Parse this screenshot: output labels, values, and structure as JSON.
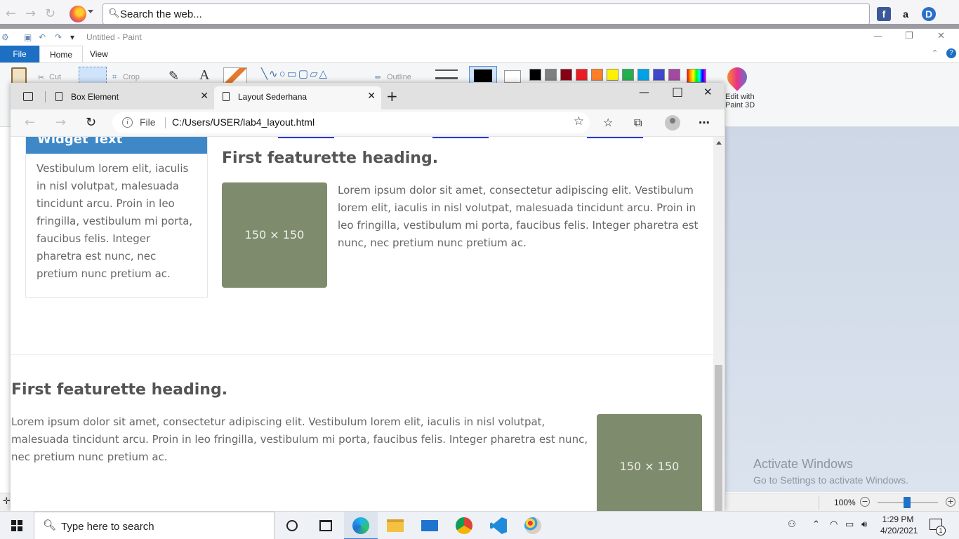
{
  "firefox": {
    "search_placeholder": "Search the web..."
  },
  "paint": {
    "title": "Untitled - Paint",
    "tabs": {
      "file": "File",
      "home": "Home",
      "view": "View"
    },
    "ribbon": {
      "cut": "Cut",
      "crop": "Crop",
      "outline": "Outline",
      "edit_with": "Edit with",
      "paint_3d": "Paint 3D",
      "colors": [
        "#000000",
        "#7f7f7f",
        "#880015",
        "#ed1c24",
        "#ff7f27",
        "#fff200",
        "#22b14c",
        "#00a2e8",
        "#3f48cc",
        "#a349a4"
      ]
    },
    "zoom": "100%",
    "activate_title": "Activate Windows",
    "activate_sub": "Go to Settings to activate Windows."
  },
  "edge": {
    "tabs": [
      {
        "label": "Box Element"
      },
      {
        "label": "Layout Sederhana"
      }
    ],
    "address": {
      "scheme": "File",
      "url": "C:/Users/USER/lab4_layout.html"
    },
    "page": {
      "widget_title": "Widget Text",
      "widget_body": "Vestibulum lorem elit, iaculis in nisl volutpat, malesuada tincidunt arcu. Proin in leo fringilla, vestibulum mi porta, faucibus felis. Integer pharetra est nunc, nec pretium nunc pretium ac.",
      "featurette1_heading": "First featurette heading.",
      "featurette1_text": "Lorem ipsum dolor sit amet, consectetur adipiscing elit. Vestibulum lorem elit, iaculis in nisl volutpat, malesuada tincidunt arcu. Proin in leo fringilla, vestibulum mi porta, faucibus felis. Integer pharetra est nunc, nec pretium nunc pretium ac.",
      "featurette2_heading": "First featurette heading.",
      "featurette2_text": "Lorem ipsum dolor sit amet, consectetur adipiscing elit. Vestibulum lorem elit, iaculis in nisl volutpat, malesuada tincidunt arcu. Proin in leo fringilla, vestibulum mi porta, faucibus felis. Integer pharetra est nunc, nec pretium nunc pretium ac.",
      "placeholder_label": "150 × 150"
    }
  },
  "taskbar": {
    "search_placeholder": "Type here to search",
    "time": "1:29 PM",
    "date": "4/20/2021",
    "notification_count": "1"
  }
}
